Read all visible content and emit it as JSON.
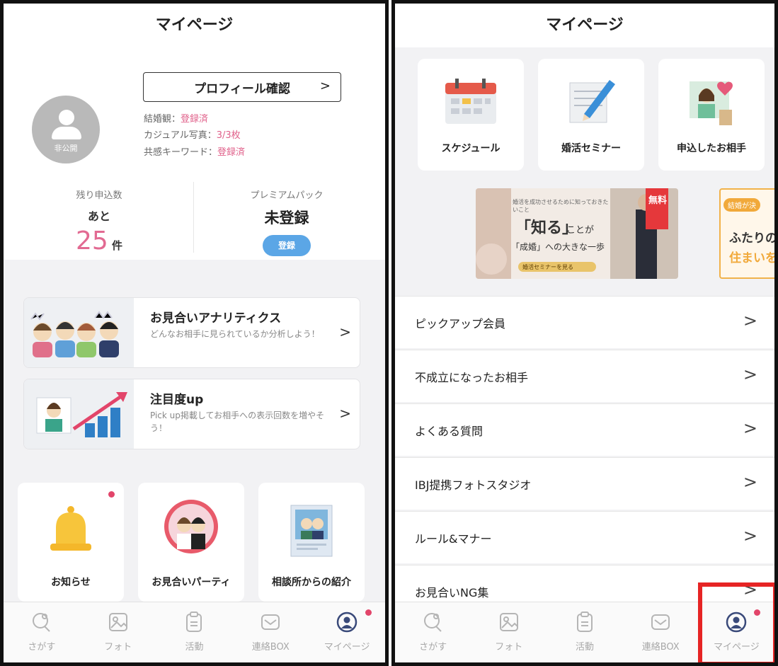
{
  "left": {
    "title": "マイページ",
    "avatar_label": "非公開",
    "profile_button": "プロフィール確認",
    "profile_chevron": ">",
    "info": [
      {
        "label": "結婚観：",
        "value": "登録済"
      },
      {
        "label": "カジュアル写真：",
        "value": "3/3枚"
      },
      {
        "label": "共感キーワード：",
        "value": "登録済"
      }
    ],
    "remaining": {
      "label": "残り申込数",
      "prefix": "あと",
      "count": "25",
      "unit": "件"
    },
    "premium": {
      "label": "プレミアムパック",
      "value": "未登録",
      "button": "登録"
    },
    "features": [
      {
        "title": "お見合いアナリティクス",
        "desc": "どんなお相手に見られているか分析しよう！",
        "chevron": ">"
      },
      {
        "title": "注目度up",
        "desc": "Pick up掲載してお相手への表示回数を増やそう！",
        "chevron": ">"
      }
    ],
    "tiles": [
      {
        "label": "お知らせ",
        "icon": "bell-icon"
      },
      {
        "label": "お見合いパーティ",
        "icon": "couple-icon"
      },
      {
        "label": "相談所からの紹介",
        "icon": "photo-couple-icon"
      }
    ]
  },
  "right": {
    "title": "マイページ",
    "tiles": [
      {
        "label": "スケジュール",
        "icon": "calendar-icon"
      },
      {
        "label": "婚活セミナー",
        "icon": "notepad-pencil-icon"
      },
      {
        "label": "申込したお相手",
        "icon": "woman-heart-icon"
      }
    ],
    "banner1": {
      "small": "婚活を成功させるために知っておきたいこと",
      "main_a": "「知る」",
      "main_b": "ことが",
      "main_c": "「成婚」への大きな一歩",
      "badge": "無料",
      "cta": "婚活セミナーを見る"
    },
    "banner2": {
      "tag": "結婚が決",
      "line1": "ふたりの",
      "line2": "住まいを"
    },
    "list": [
      {
        "label": "ピックアップ会員"
      },
      {
        "label": "不成立になったお相手"
      },
      {
        "label": "よくある質問"
      },
      {
        "label": "IBJ提携フォトスタジオ"
      },
      {
        "label": "ルール&マナー"
      },
      {
        "label": "お見合いNG集"
      }
    ],
    "list_chevron": ">"
  },
  "tabbar": [
    {
      "label": "さがす",
      "icon": "search-person-icon"
    },
    {
      "label": "フォト",
      "icon": "photo-icon"
    },
    {
      "label": "活動",
      "icon": "clipboard-icon"
    },
    {
      "label": "連絡BOX",
      "icon": "mail-icon"
    },
    {
      "label": "マイページ",
      "icon": "profile-icon"
    }
  ],
  "colors": {
    "accent_pink": "#e26a92",
    "badge_red": "#e2456a",
    "highlight_red": "#e62424",
    "button_blue": "#5ba6e6"
  }
}
